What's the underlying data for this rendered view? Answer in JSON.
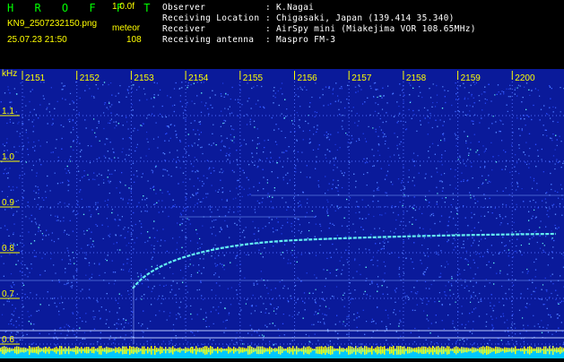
{
  "header": {
    "app_title": "H R O F F T",
    "version": "1.0.0f",
    "filename": "KN9_2507232150.png",
    "datetime": "25.07.23 21:50",
    "mode_label": "meteor",
    "count": "108"
  },
  "station": {
    "rows": [
      {
        "label": "Observer",
        "value": ": K.Nagai"
      },
      {
        "label": "Receiving Location",
        "value": ": Chigasaki, Japan (139.414 35.340)"
      },
      {
        "label": "Receiver",
        "value": ": AirSpy mini (Miakejima VOR 108.65MHz)"
      },
      {
        "label": "Receiving antenna",
        "value": ": Maspro FM-3"
      }
    ]
  },
  "spectrogram": {
    "y_unit": "kHz",
    "time_ticks": [
      "2151",
      "2152",
      "2153",
      "2154",
      "2155",
      "2156",
      "2157",
      "2158",
      "2159",
      "2200"
    ],
    "freq_ticks": [
      "1.1",
      "1.0",
      "0.9",
      "0.8",
      "0.7",
      "0.6"
    ],
    "colors": {
      "background": "#0a1a9a",
      "noise": "#3c64ff",
      "bright": "#63f0f0",
      "tick": "#ffff00",
      "baseline": "#00c8ff"
    }
  }
}
